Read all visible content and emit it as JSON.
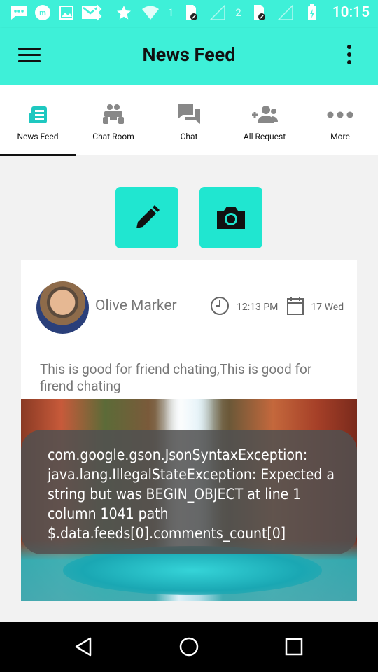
{
  "status_bar": {
    "time": "10:15",
    "sim1": "1",
    "sim2": "2"
  },
  "app_bar": {
    "title": "News Feed"
  },
  "tabs": [
    {
      "label": "News Feed",
      "icon": "news-feed-icon",
      "active": true
    },
    {
      "label": "Chat Room",
      "icon": "chat-room-icon",
      "active": false
    },
    {
      "label": "Chat",
      "icon": "chat-icon",
      "active": false
    },
    {
      "label": "All Request",
      "icon": "all-request-icon",
      "active": false
    },
    {
      "label": "More",
      "icon": "more-icon",
      "active": false
    }
  ],
  "actions": {
    "edit_icon": "pencil-icon",
    "camera_icon": "camera-icon"
  },
  "post": {
    "user_name": "Olive Marker",
    "time": "12:13 PM",
    "date": "17 Wed",
    "text": "This is good for friend chating,This is good for firend chating"
  },
  "toast": {
    "message": "com.google.gson.JsonSyntaxException: java.lang.IllegalStateException: Expected a string but was BEGIN_OBJECT at line 1 column 1041 path $.data.feeds[0].comments_count[0]"
  },
  "colors": {
    "accent": "#3ef0d8",
    "button": "#20e6d0"
  }
}
